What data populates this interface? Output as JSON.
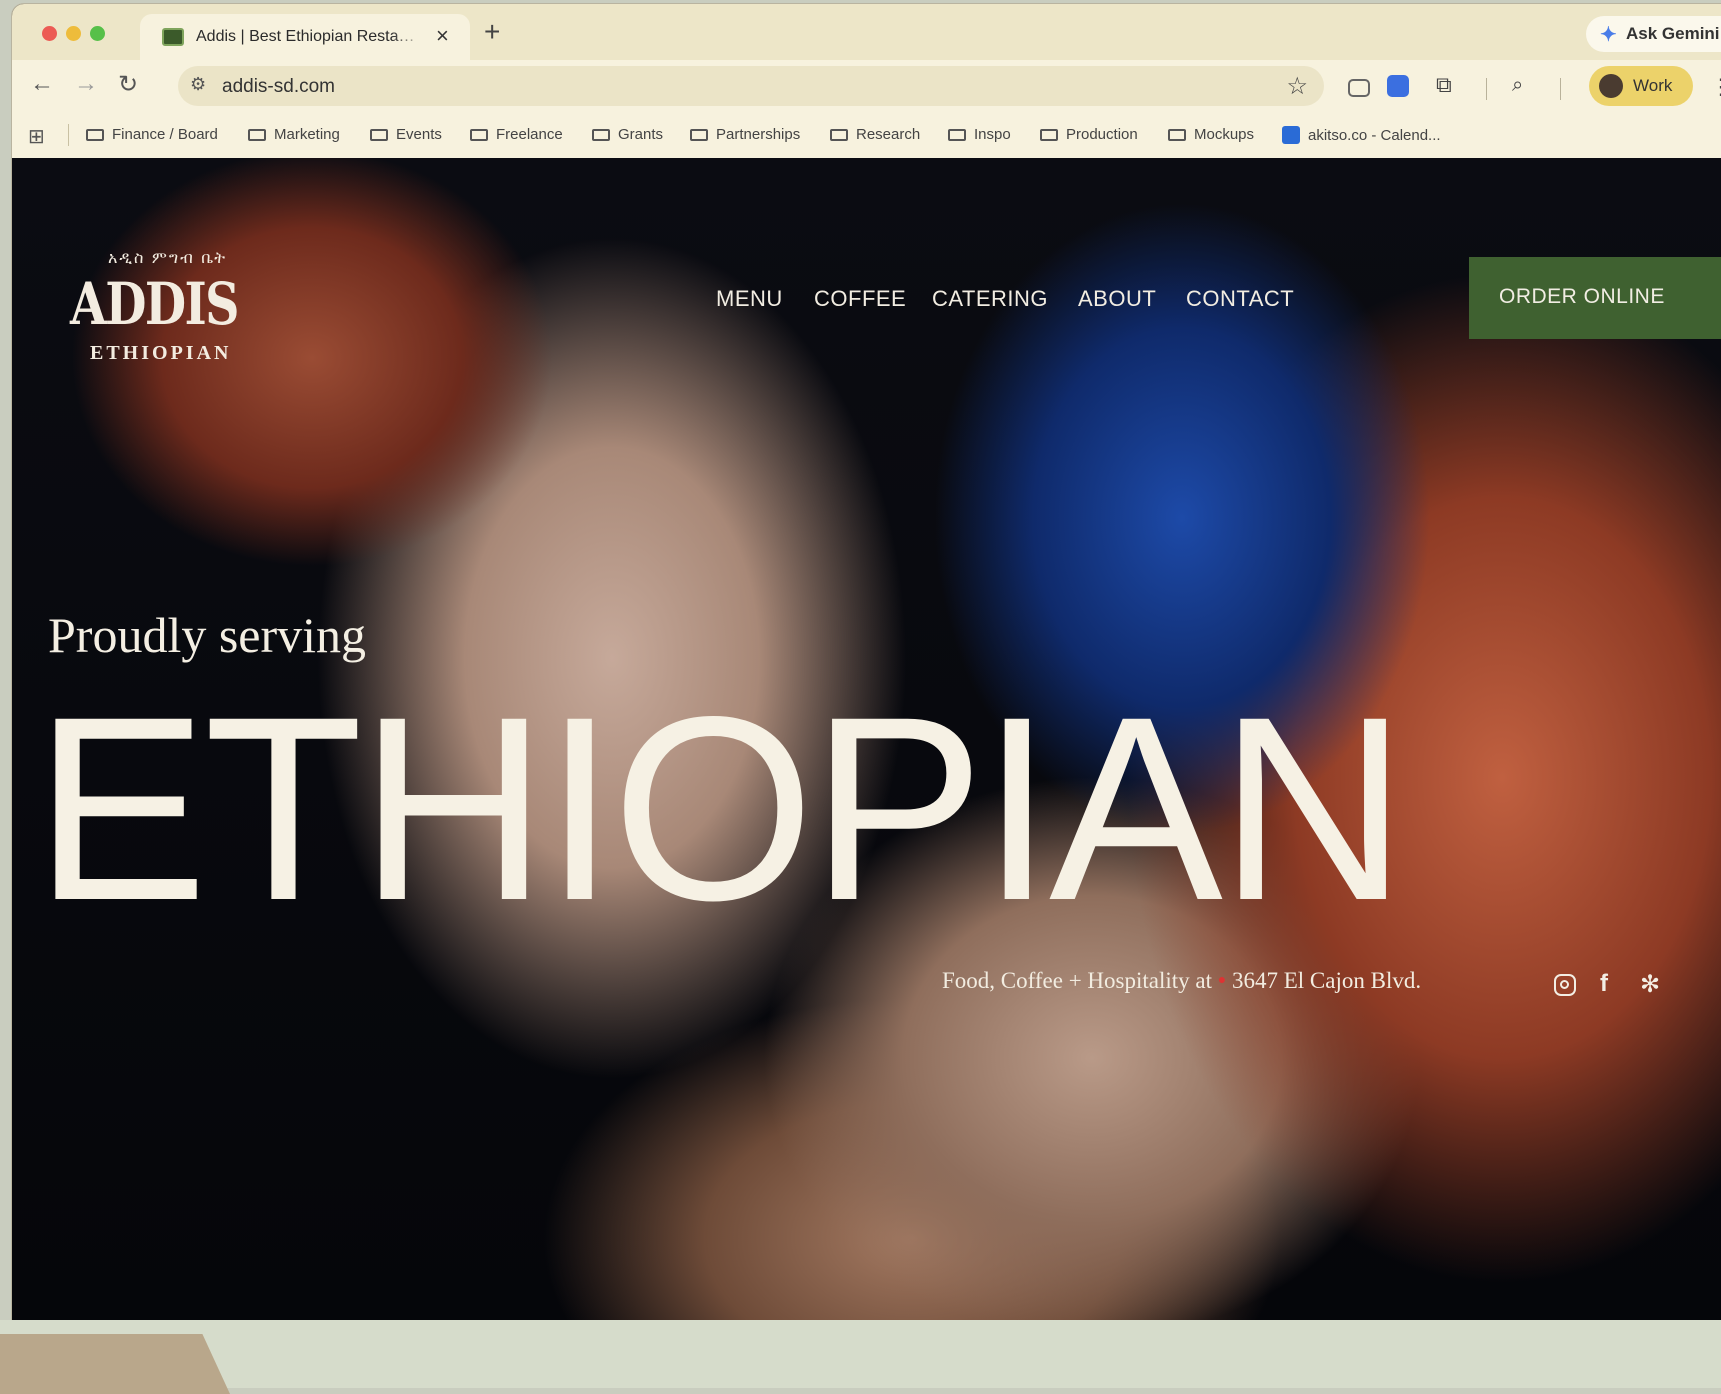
{
  "browser": {
    "tab_title": "Addis | Best Ethiopian Resta…",
    "tab_close": "×",
    "new_tab": "+",
    "gemini_label": "Ask Gemini",
    "url": "addis-sd.com",
    "profile_label": "Work",
    "bookmarks": [
      "Finance / Board",
      "Marketing",
      "Events",
      "Freelance",
      "Grants",
      "Partnerships",
      "Research",
      "Inspo",
      "Production",
      "Mockups",
      "akitso.co - Calend..."
    ]
  },
  "site": {
    "logo_main": "ADDIS",
    "logo_sub": "ETHIOPIAN",
    "logo_script": "አዲስ ምግብ ቤት",
    "nav": [
      "MENU",
      "COFFEE",
      "CATERING",
      "ABOUT",
      "CONTACT"
    ],
    "order_button": "ORDER ONLINE",
    "tagline": "Proudly serving",
    "headline": "ETHIOPIAN",
    "address_prefix": "Food, Coffee + Hospitality at",
    "address": "3647 El Cajon Blvd.",
    "accent_green": "#3f6130"
  },
  "icons": {
    "back": "arrow-left-icon",
    "forward": "arrow-right-icon",
    "reload": "reload-icon",
    "social": [
      "instagram-icon",
      "facebook-icon",
      "yelp-icon"
    ]
  }
}
